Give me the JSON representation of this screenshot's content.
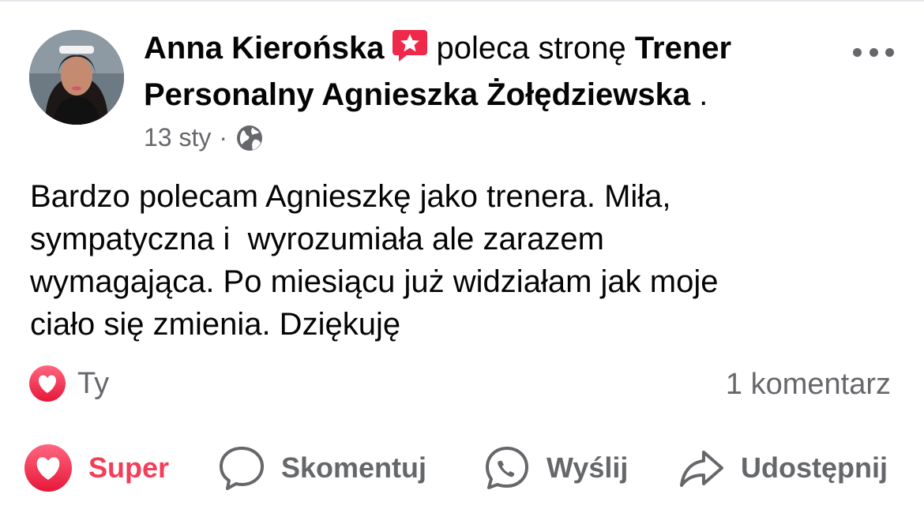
{
  "post": {
    "author": "Anna Kierońska",
    "verb": "poleca stronę",
    "page_name": "Trener Personalny Agnieszka Żołędziewska",
    "page_suffix": " .",
    "date": "13 sty",
    "separator": "·",
    "audience_icon": "globe-icon",
    "recommend_icon": "recommendation-star-icon",
    "more_icon": "more-options-icon",
    "text": "Bardzo polecam Agnieszkę jako trenera. Miła,\nsympatyczna i  wyrozumiała ale zarazem\nwymagająca. Po miesiącu już widziałam jak moje\nciało się zmienia. Dziękuję"
  },
  "reactions": {
    "icon": "love-reaction-icon",
    "label": "Ty",
    "comments_count": "1 komentarz"
  },
  "actions": {
    "super": {
      "label": "Super",
      "icon": "heart-icon",
      "color": "#f33e58"
    },
    "comment": {
      "label": "Skomentuj",
      "icon": "comment-bubble-icon"
    },
    "send": {
      "label": "Wyślij",
      "icon": "messenger-icon"
    },
    "share": {
      "label": "Udostępnij",
      "icon": "share-arrow-icon"
    }
  },
  "colors": {
    "secondary_text": "#65676b",
    "primary_text": "#050505",
    "recommend_badge": "#f02849",
    "love": "#f33e58"
  }
}
